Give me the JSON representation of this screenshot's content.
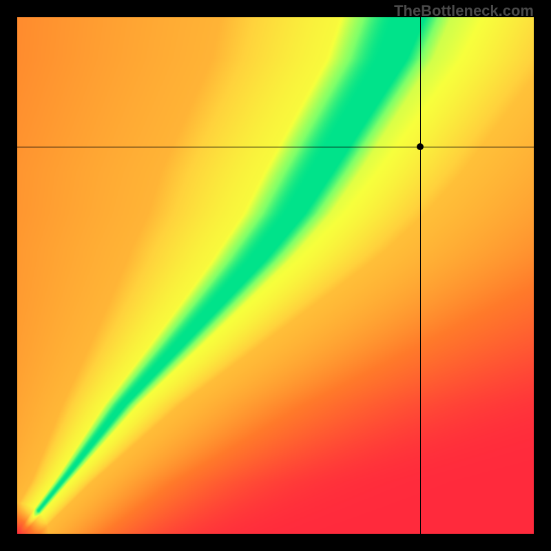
{
  "watermark": "TheBottleneck.com",
  "chart_data": {
    "type": "heatmap",
    "title": "",
    "xlabel": "",
    "ylabel": "",
    "xlim": [
      0,
      100
    ],
    "ylim": [
      0,
      100
    ],
    "legend": false,
    "crosshair": {
      "x": 78,
      "y": 75
    },
    "point": {
      "x": 78,
      "y": 75
    },
    "color_scale": [
      {
        "value": 0.0,
        "color": "#ff2a3c"
      },
      {
        "value": 0.35,
        "color": "#ff7a2a"
      },
      {
        "value": 0.6,
        "color": "#ffd23c"
      },
      {
        "value": 0.78,
        "color": "#f7ff3c"
      },
      {
        "value": 0.92,
        "color": "#7eff6a"
      },
      {
        "value": 1.0,
        "color": "#00e38a"
      }
    ],
    "ridge": {
      "description": "Optimal balance curve (green ridge) from bottom-left to top-right",
      "points_xy": [
        [
          2,
          2
        ],
        [
          10,
          12
        ],
        [
          20,
          25
        ],
        [
          30,
          36
        ],
        [
          38,
          45
        ],
        [
          45,
          53
        ],
        [
          52,
          62
        ],
        [
          58,
          72
        ],
        [
          64,
          82
        ],
        [
          70,
          92
        ],
        [
          73,
          100
        ]
      ],
      "width_profile": [
        [
          0,
          0.5
        ],
        [
          10,
          1.5
        ],
        [
          25,
          4
        ],
        [
          40,
          7
        ],
        [
          55,
          10
        ],
        [
          70,
          12
        ],
        [
          85,
          13
        ],
        [
          100,
          14
        ]
      ]
    },
    "corner_values": {
      "bottom_left": 0.0,
      "bottom_right": 0.0,
      "top_left": 0.0,
      "top_right": 0.55
    }
  }
}
